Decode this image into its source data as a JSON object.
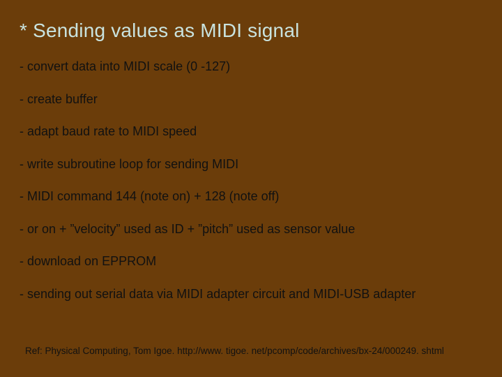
{
  "title": "* Sending values as MIDI signal",
  "bullets": {
    "b0": "- convert data into MIDI scale (0 -127)",
    "b1": "- create buffer",
    "b2": "- adapt baud rate to MIDI speed",
    "b3": "- write subroutine loop for sending MIDI",
    "b4": "- MIDI command 144 (note on) + 128 (note off)",
    "b5": "- or on + ”velocity” used as ID + ”pitch” used as sensor value",
    "b6": "- download on EPPROM",
    "b7": "- sending out serial data via MIDI adapter circuit and MIDI-USB adapter"
  },
  "reference": "Ref: Physical Computing, Tom Igoe. http://www. tigoe. net/pcomp/code/archives/bx-24/000249. shtml"
}
